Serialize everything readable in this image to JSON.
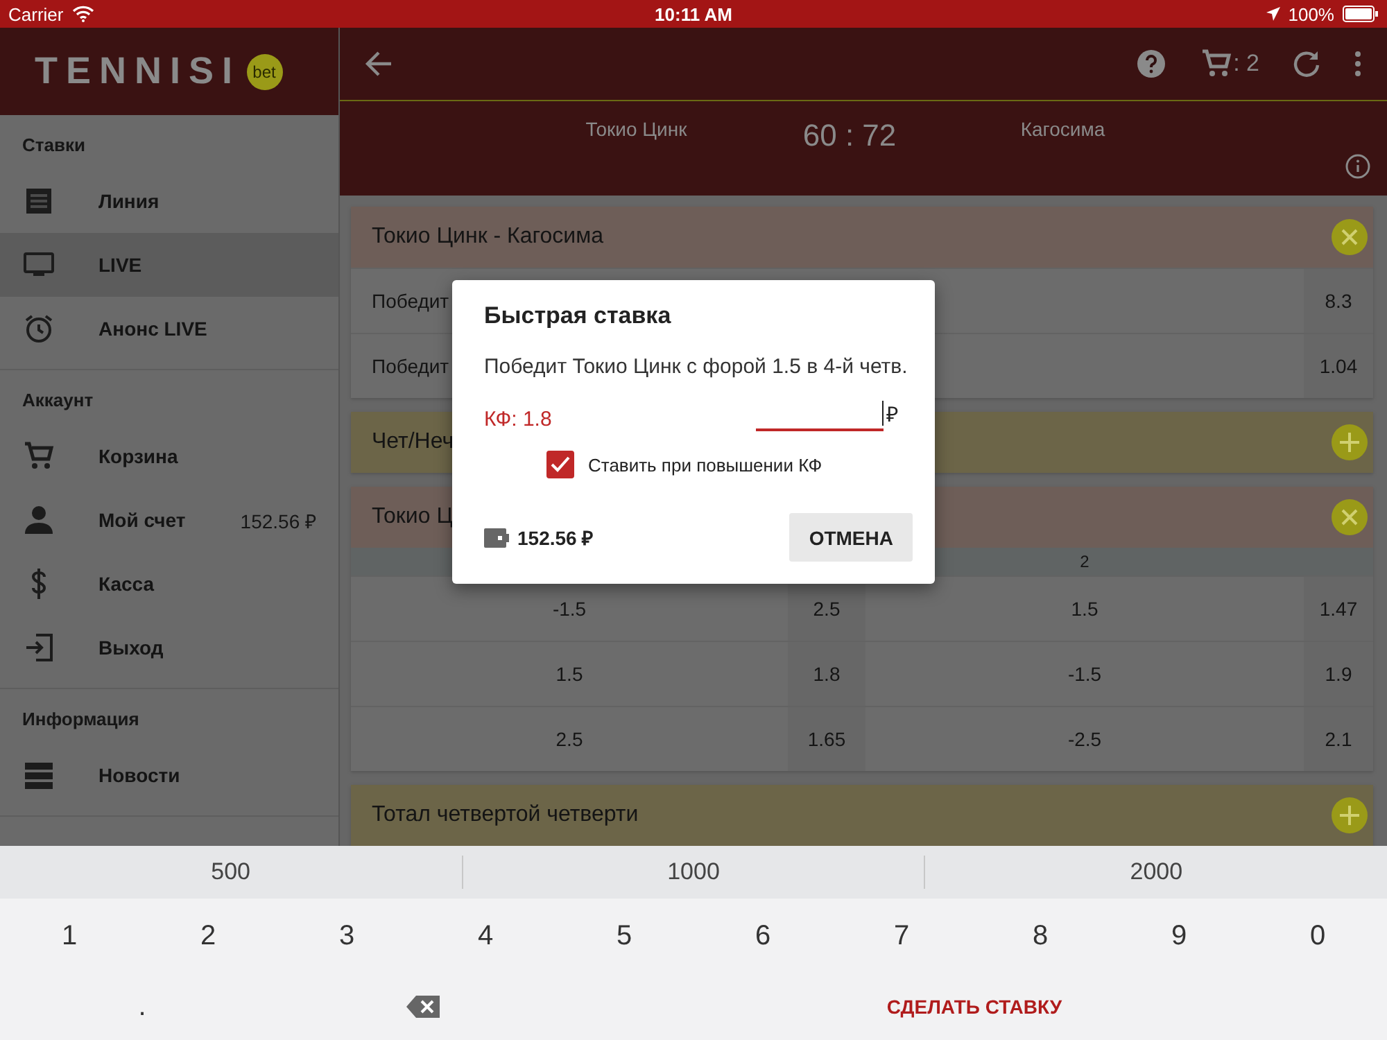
{
  "status_bar": {
    "carrier": "Carrier",
    "time": "10:11 AM",
    "battery": "100%"
  },
  "sidebar": {
    "logo": "TENNISI",
    "logo_badge": "bet",
    "sections": [
      {
        "title": "Ставки",
        "items": [
          {
            "label": "Линия",
            "selected": false
          },
          {
            "label": "LIVE",
            "selected": true
          },
          {
            "label": "Анонс LIVE",
            "selected": false
          }
        ]
      },
      {
        "title": "Аккаунт",
        "items": [
          {
            "label": "Корзина",
            "selected": false
          },
          {
            "label": "Мой счет",
            "value": "152.56 ₽",
            "selected": false
          },
          {
            "label": "Касса",
            "selected": false
          },
          {
            "label": "Выход",
            "selected": false
          }
        ]
      },
      {
        "title": "Информация",
        "items": [
          {
            "label": "Новости",
            "selected": false
          }
        ]
      }
    ]
  },
  "toolbar": {
    "cart_count": ": 2"
  },
  "match": {
    "home": "Токио Цинк",
    "score": "60 : 72",
    "away": "Кагосима"
  },
  "markets": [
    {
      "title": "Токио Цинк - Кагосима",
      "expanded": true,
      "rows": [
        {
          "label": "Победит",
          "odds": "8.3"
        },
        {
          "label": "Победит",
          "odds": "1.04"
        }
      ]
    },
    {
      "title": "Чет/Неч",
      "expanded": false
    },
    {
      "title": "Токио Ц",
      "expanded": true,
      "table_header": "2",
      "table_rows": [
        [
          "-1.5",
          "2.5",
          "1.5",
          "1.47"
        ],
        [
          "1.5",
          "1.8",
          "-1.5",
          "1.9"
        ],
        [
          "2.5",
          "1.65",
          "-2.5",
          "2.1"
        ]
      ]
    },
    {
      "title": "Тотал четвертой четверти",
      "expanded": false
    }
  ],
  "dialog": {
    "title": "Быстрая ставка",
    "text": "Победит Токио Цинк с форой 1.5 в 4-й четв.",
    "coefficient": "КФ: 1.8",
    "currency": "₽",
    "checkbox": {
      "label": "Ставить при повышении КФ",
      "checked": true
    },
    "balance": "152.56 ₽",
    "cancel": "ОТМЕНА"
  },
  "keyboard": {
    "suggestions": [
      "500",
      "1000",
      "2000"
    ],
    "keys": [
      "1",
      "2",
      "3",
      "4",
      "5",
      "6",
      "7",
      "8",
      "9",
      "0"
    ],
    "dot": ".",
    "submit": "СДЕЛАТЬ СТАВКУ"
  }
}
